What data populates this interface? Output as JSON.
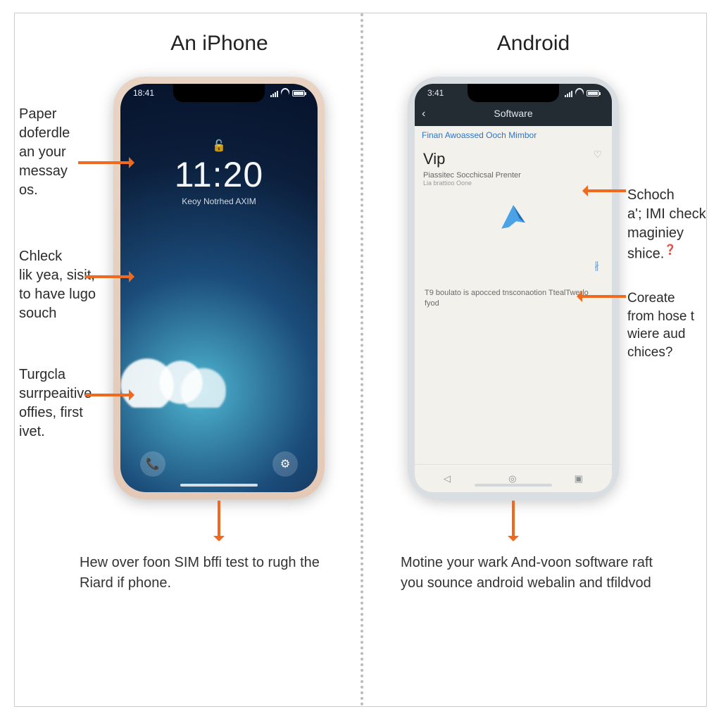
{
  "titles": {
    "left": "An iPhone",
    "right": "Android"
  },
  "iphone": {
    "status_time": "18:41",
    "lock_icon": "🔓",
    "clock": "11:20",
    "subline": "Keoy Notrhed AXIM",
    "phone_glyph": "📞",
    "gear_glyph": "⚙"
  },
  "android": {
    "status_time": "3:41",
    "title": "Software",
    "blue_line": "Finan Awoassed Ooch Mimbor",
    "vip": "Vip",
    "sub1": "Piassitec Socchicsal Prenter",
    "sub2": "Lia brattioo Oone",
    "body": "T9 boulato is apocced tnsconaotion TtealTwerlo fyod",
    "nav": {
      "back": "◁",
      "home": "◎",
      "recent": "▣"
    }
  },
  "left_callouts": {
    "c1": "Paper\ndoferdle\nan your\nmessay\nos.",
    "c2": "Chleck\nlik yea, sisit,\nto have lugo\nsouch",
    "c3": "Turgcla\nsurrpeaitive\noffies, first\nivet."
  },
  "right_callouts": {
    "c1": "Schoch\na'; IMI check\nmaginiey\nshice.",
    "c2": "Coreate\nfrom hose t\nwiere aud\nchices?"
  },
  "captions": {
    "left": "Hew over foon SIM bffi test\nto rugh the Riard if phone.",
    "right": "Motine your wark And-voon\nsoftware raft you sounce\nandroid webalin and tfildvod"
  }
}
